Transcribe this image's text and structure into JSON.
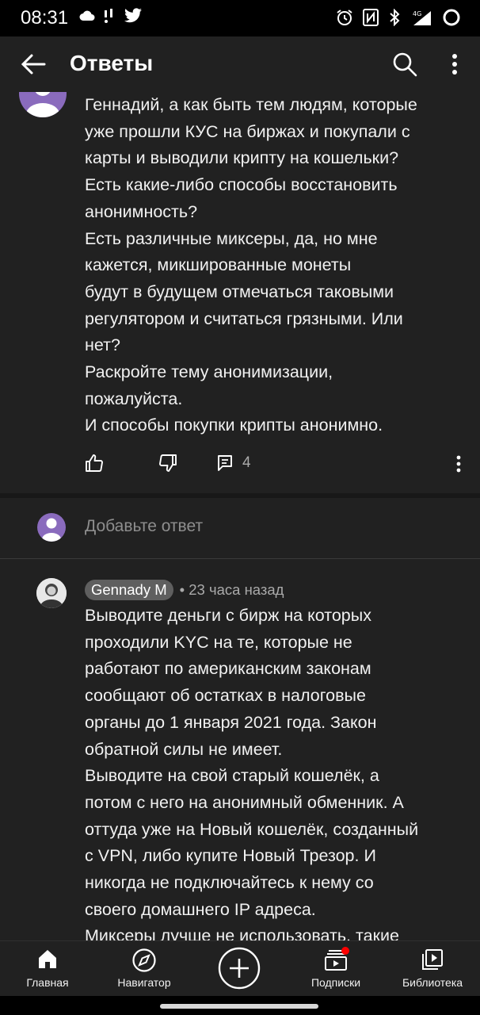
{
  "status_bar": {
    "time": "08:31"
  },
  "app_bar": {
    "title": "Ответы"
  },
  "parent_comment": {
    "text": "Геннадий, а как быть тем людям, которые\nуже прошли КУС на биржах и покупали с\nкарты и выводили крипту на кошельки?\nЕсть какие-либо способы восстановить\nанонимность?\nЕсть различные миксеры, да, но мне\nкажется, микшированные монеты\nбудут в будущем отмечаться таковыми\nрегулятором и считаться грязными. Или\nнет?\nРаскройте тему анонимизации,\nпожалуйста.\nИ способы покупки крипты анонимно.",
    "reply_count": "4"
  },
  "add_reply": {
    "placeholder": "Добавьте ответ"
  },
  "reply": {
    "author": "Gennady M",
    "time": "• 23 часа назад",
    "text": "Выводите деньги с бирж на которых\nпроходили KYC на те, которые не\nработают по американским законам\nсообщают об остатках  в налоговые\nорганы до 1 января 2021 года. Закон\nобратной силы не имеет.\nВыводите на свой старый кошелёк, а\nпотом с него на анонимный обменник. А\nоттуда уже на Новый кошелёк, созданный\nс VPN, либо купите Новый Трезор. И\nникогда не подключайтесь к нему со\nсвоего домашнего IP адреса.\nМиксеры лучше не использовать, такие"
  },
  "bottom_nav": {
    "home": "Главная",
    "explore": "Навигатор",
    "subscriptions": "Подписки",
    "library": "Библиотека"
  },
  "colors": {
    "accent_red": "#ff0000",
    "avatar_purple": "#8a6bbd",
    "background": "#212121"
  }
}
